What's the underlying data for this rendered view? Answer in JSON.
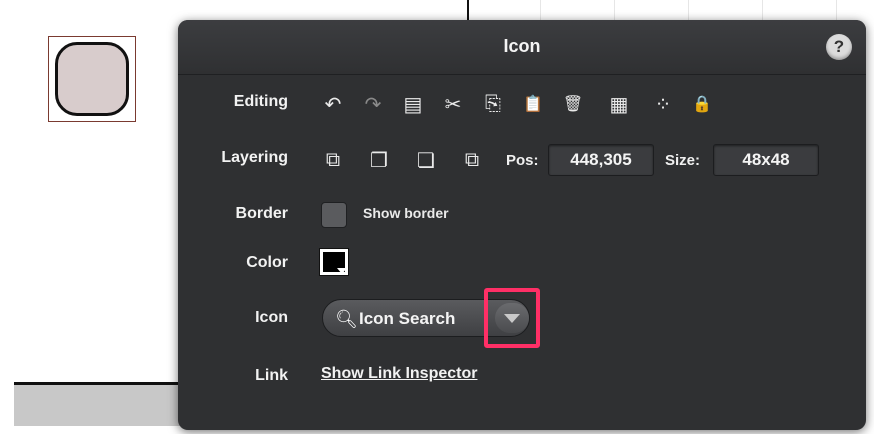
{
  "panel": {
    "title": "Icon",
    "help_label": "?"
  },
  "rows": {
    "editing_label": "Editing",
    "layering_label": "Layering",
    "border_label": "Border",
    "color_label": "Color",
    "icon_label": "Icon",
    "link_label": "Link"
  },
  "editing_tools": [
    {
      "name": "undo-icon",
      "glyph": "↶"
    },
    {
      "name": "redo-icon",
      "glyph": "↷"
    },
    {
      "name": "duplicate-icon",
      "glyph": "▤"
    },
    {
      "name": "cut-icon",
      "glyph": "✂"
    },
    {
      "name": "copy-icon",
      "glyph": "⎘"
    },
    {
      "name": "paste-icon",
      "glyph": "📋"
    },
    {
      "name": "delete-icon",
      "glyph": "🗑"
    },
    {
      "name": "group-icon",
      "glyph": "▦"
    },
    {
      "name": "ungroup-icon",
      "glyph": "⁘"
    },
    {
      "name": "lock-icon",
      "glyph": "🔒"
    }
  ],
  "layering_tools": [
    {
      "name": "bring-to-front-icon",
      "glyph": "⧉"
    },
    {
      "name": "bring-forward-icon",
      "glyph": "❐"
    },
    {
      "name": "send-backward-icon",
      "glyph": "❏"
    },
    {
      "name": "send-to-back-icon",
      "glyph": "⧉"
    }
  ],
  "position": {
    "label": "Pos:",
    "value": "448,305"
  },
  "size": {
    "label": "Size:",
    "value": "48x48"
  },
  "border": {
    "checkbox_label": "Show border",
    "checked": false
  },
  "color": {
    "value": "#000000"
  },
  "icon_search": {
    "placeholder": "Icon Search"
  },
  "link": {
    "text": "Show Link Inspector"
  },
  "colors": {
    "panel_bg": "#2f3032",
    "highlight": "#ff2f66",
    "canvas_shape_fill": "#d8cccc"
  }
}
